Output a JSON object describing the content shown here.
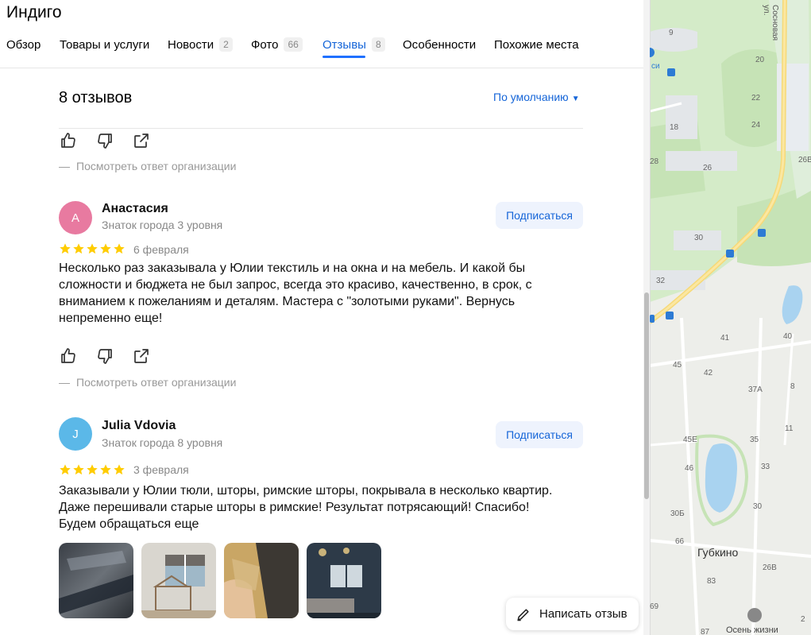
{
  "org": {
    "title": "Индиго"
  },
  "tabs": [
    {
      "label": "Обзор",
      "count": ""
    },
    {
      "label": "Товары и услуги",
      "count": ""
    },
    {
      "label": "Новости",
      "count": "2"
    },
    {
      "label": "Фото",
      "count": "66"
    },
    {
      "label": "Отзывы",
      "count": "8"
    },
    {
      "label": "Особенности",
      "count": ""
    },
    {
      "label": "Похожие места",
      "count": ""
    }
  ],
  "active_tab": "Отзывы",
  "reviews_header": {
    "count_label": "8 отзывов",
    "sort_label": "По умолчанию"
  },
  "answer_link_label": "Посмотреть ответ организации",
  "subscribe_label": "Подписаться",
  "reviews": [
    {
      "initial": "А",
      "avatar_color": "#e87aa0",
      "author": "Анастасия",
      "level": "Знаток города 3 уровня",
      "rating": 5,
      "date": "6 февраля",
      "text": "Несколько раз заказывала у Юлии текстиль и на окна и на мебель. И какой бы сложности и бюджета не был запрос, всегда это красиво, качественно, в срок, с вниманием к пожеланиям и деталям. Мастера с \"золотыми руками\". Вернусь непременно еще!"
    },
    {
      "initial": "J",
      "avatar_color": "#5bb8e8",
      "author": "Julia Vdovia",
      "level": "Знаток города 8 уровня",
      "rating": 5,
      "date": "3 февраля",
      "text": "Заказывали у Юлии тюли, шторы, римские шторы, покрывала в несколько квартир. Даже перешивали старые шторы в римские! Результат потрясающий! Спасибо! Будем обращаться еще"
    }
  ],
  "write_review_label": "Написать отзыв",
  "colors": {
    "accent": "#1565d8",
    "star": "#ffcc00",
    "subscribe_bg": "#eef3fd"
  },
  "map": {
    "street": "Сосновая ул.",
    "district": "Губкино",
    "poi": "Осень жизни",
    "partial_label": "си",
    "house_numbers": [
      "9",
      "20",
      "22",
      "18",
      "24",
      "28",
      "26",
      "26В",
      "30",
      "32",
      "41",
      "40",
      "45",
      "42",
      "8",
      "37А",
      "11",
      "45Е",
      "35",
      "46",
      "33",
      "30",
      "30Б",
      "66",
      "26В",
      "83",
      "69",
      "87",
      "2"
    ]
  }
}
